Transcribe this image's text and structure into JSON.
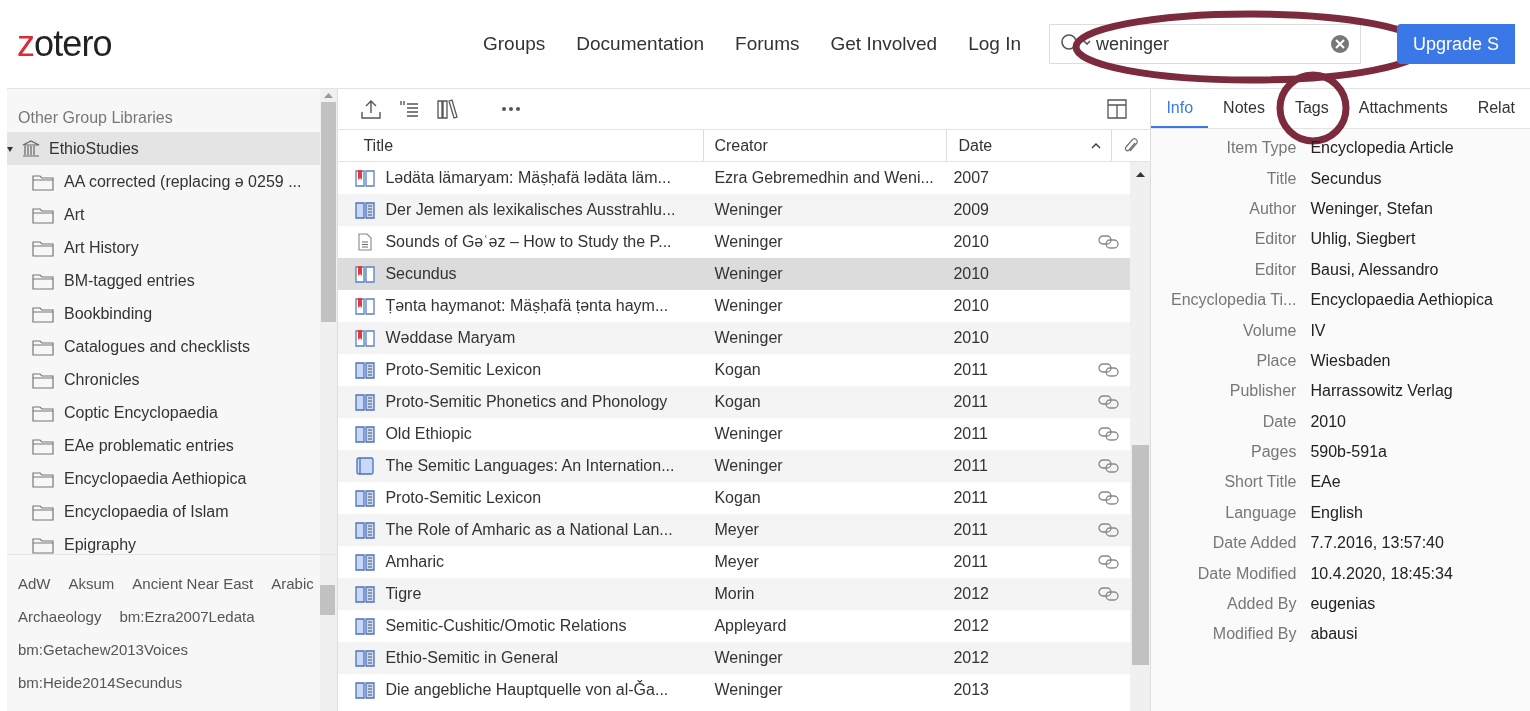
{
  "header": {
    "logo_accent": "z",
    "logo_rest": "otero",
    "nav": [
      "Groups",
      "Documentation",
      "Forums",
      "Get Involved",
      "Log In"
    ],
    "search": {
      "value": "weninger"
    },
    "upgrade_button": "Upgrade S"
  },
  "collections": {
    "heading": "Other Group Libraries",
    "group": {
      "label": "EthioStudies",
      "expanded": true,
      "selected": true,
      "children": [
        {
          "label": "AA corrected (replacing ə 0259 ..."
        },
        {
          "label": "Art"
        },
        {
          "label": "Art History"
        },
        {
          "label": "BM-tagged entries"
        },
        {
          "label": "Bookbinding"
        },
        {
          "label": "Catalogues and checklists"
        },
        {
          "label": "Chronicles"
        },
        {
          "label": "Coptic Encyclopaedia"
        },
        {
          "label": "EAe problematic entries"
        },
        {
          "label": "Encyclopaedia Aethiopica"
        },
        {
          "label": "Encyclopaedia of Islam"
        },
        {
          "label": "Epigraphy"
        }
      ]
    }
  },
  "tags": [
    "AdW",
    "Aksum",
    "Ancient Near East",
    "Arabic",
    "Archaeology",
    "bm:Ezra2007Ledata",
    "bm:Getachew2013Voices",
    "bm:Heide2014Secundus"
  ],
  "table": {
    "columns": [
      "Title",
      "Creator",
      "Date"
    ],
    "rows": [
      {
        "kind": "section",
        "title": "Lədäta lämaryam: Mäṣḥafä lədäta läm...",
        "creator": "Ezra Gebremedhin and Weni...",
        "date": "2007",
        "linked": false,
        "selected": false
      },
      {
        "kind": "article",
        "title": "Der Jemen als lexikalisches Ausstrahlu...",
        "creator": "Weninger",
        "date": "2009",
        "linked": false,
        "selected": false
      },
      {
        "kind": "document",
        "title": "Sounds of Gəʿəz – How to Study the P...",
        "creator": "Weninger",
        "date": "2010",
        "linked": true,
        "selected": false
      },
      {
        "kind": "section",
        "title": "Secundus",
        "creator": "Weninger",
        "date": "2010",
        "linked": false,
        "selected": true
      },
      {
        "kind": "section",
        "title": "Ṭənta haymanot: Mäṣḥafä ṭənta haym...",
        "creator": "Weninger",
        "date": "2010",
        "linked": false,
        "selected": false
      },
      {
        "kind": "section",
        "title": "Wəddase Maryam",
        "creator": "Weninger",
        "date": "2010",
        "linked": false,
        "selected": false
      },
      {
        "kind": "article",
        "title": "Proto-Semitic Lexicon",
        "creator": "Kogan",
        "date": "2011",
        "linked": true,
        "selected": false
      },
      {
        "kind": "article",
        "title": "Proto-Semitic Phonetics and Phonology",
        "creator": "Kogan",
        "date": "2011",
        "linked": true,
        "selected": false
      },
      {
        "kind": "article",
        "title": "Old Ethiopic",
        "creator": "Weninger",
        "date": "2011",
        "linked": true,
        "selected": false
      },
      {
        "kind": "book",
        "title": "The Semitic Languages: An Internation...",
        "creator": "Weninger",
        "date": "2011",
        "linked": true,
        "selected": false
      },
      {
        "kind": "article",
        "title": "Proto-Semitic Lexicon",
        "creator": "Kogan",
        "date": "2011",
        "linked": true,
        "selected": false
      },
      {
        "kind": "article",
        "title": "The Role of Amharic as a National Lan...",
        "creator": "Meyer",
        "date": "2011",
        "linked": true,
        "selected": false
      },
      {
        "kind": "article",
        "title": "Amharic",
        "creator": "Meyer",
        "date": "2011",
        "linked": true,
        "selected": false
      },
      {
        "kind": "article",
        "title": "Tigre",
        "creator": "Morin",
        "date": "2012",
        "linked": true,
        "selected": false
      },
      {
        "kind": "article",
        "title": "Semitic-Cushitic/Omotic Relations",
        "creator": "Appleyard",
        "date": "2012",
        "linked": false,
        "selected": false
      },
      {
        "kind": "article",
        "title": "Ethio-Semitic in General",
        "creator": "Weninger",
        "date": "2012",
        "linked": false,
        "selected": false
      },
      {
        "kind": "article",
        "title": "Die angebliche Hauptquelle von al-Ǧa...",
        "creator": "Weninger",
        "date": "2013",
        "linked": false,
        "selected": false
      }
    ]
  },
  "details": {
    "tabs": [
      {
        "label": "Info",
        "selected": true
      },
      {
        "label": "Notes",
        "selected": false
      },
      {
        "label": "Tags",
        "selected": false
      },
      {
        "label": "Attachments",
        "selected": false
      },
      {
        "label": "Relat",
        "selected": false
      }
    ],
    "fields": [
      {
        "label": "Item Type",
        "value": "Encyclopedia Article"
      },
      {
        "label": "Title",
        "value": "Secundus"
      },
      {
        "label": "Author",
        "value": "Weninger, Stefan"
      },
      {
        "label": "Editor",
        "value": "Uhlig, Siegbert"
      },
      {
        "label": "Editor",
        "value": "Bausi, Alessandro"
      },
      {
        "label": "Encyclopedia Ti...",
        "value": "Encyclopaedia Aethiopica"
      },
      {
        "label": "Volume",
        "value": "IV"
      },
      {
        "label": "Place",
        "value": "Wiesbaden"
      },
      {
        "label": "Publisher",
        "value": "Harrassowitz Verlag"
      },
      {
        "label": "Date",
        "value": "2010"
      },
      {
        "label": "Pages",
        "value": "590b-591a"
      },
      {
        "label": "Short Title",
        "value": "EAe"
      },
      {
        "label": "Language",
        "value": "English"
      },
      {
        "label": "Date Added",
        "value": "7.7.2016, 13:57:40"
      },
      {
        "label": "Date Modified",
        "value": "10.4.2020, 18:45:34"
      },
      {
        "label": "Added By",
        "value": "eugenias"
      },
      {
        "label": "Modified By",
        "value": "abausi"
      }
    ]
  }
}
